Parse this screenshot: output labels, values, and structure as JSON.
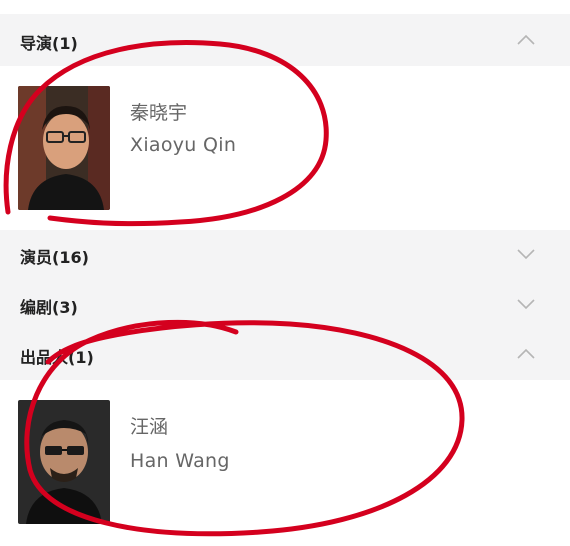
{
  "sections": [
    {
      "title": "导演(1)",
      "chevron": "chevron-up-icon",
      "expanded": true
    },
    {
      "title": "演员(16)",
      "chevron": "chevron-down-icon",
      "expanded": false
    },
    {
      "title": "编剧(3)",
      "chevron": "chevron-down-icon",
      "expanded": false
    },
    {
      "title": "出品人(1)",
      "chevron": "chevron-up-icon",
      "expanded": true
    }
  ],
  "people": [
    {
      "name_cn": "秦晓宇",
      "name_en": "Xiaoyu Qin",
      "photo": "portrait-photo"
    },
    {
      "name_cn": "汪涵",
      "name_en": "Han Wang",
      "photo": "portrait-photo"
    }
  ],
  "colors": {
    "section_bg": "#f4f4f5",
    "text_primary": "#222222",
    "text_secondary": "#666666",
    "annotation": "#d4001e"
  }
}
